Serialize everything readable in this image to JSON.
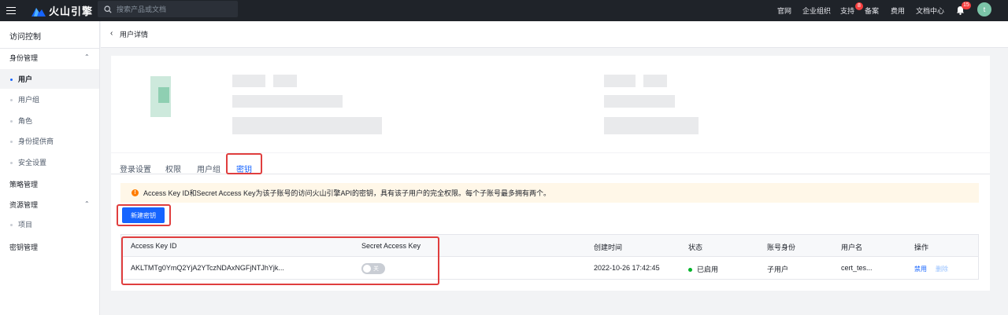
{
  "topbar": {
    "logo_text": "火山引擎",
    "search_placeholder": "搜索产品或文档",
    "nav": [
      "官网",
      "企业组织",
      "支持",
      "备案",
      "费用",
      "文档中心"
    ],
    "support_badge": "8",
    "bell_badge": "15",
    "avatar_letter": "t"
  },
  "sidebar": {
    "title": "访问控制",
    "group_identity": "身份管理",
    "identity_items": [
      "用户",
      "用户组",
      "角色",
      "身份提供商",
      "安全设置"
    ],
    "policy": "策略管理",
    "group_resource": "资源管理",
    "resource_items": [
      "项目"
    ],
    "key_mgmt": "密钥管理"
  },
  "header": {
    "back_glyph": "‹",
    "title": "用户详情"
  },
  "tabs": [
    "登录设置",
    "权限",
    "用户组",
    "密钥"
  ],
  "notice": {
    "text": "Access Key ID和Secret Access Key为该子账号的访问火山引擎API的密钥，具有该子用户的完全权限。每个子账号最多拥有两个。"
  },
  "new_key_button": "新建密钥",
  "table": {
    "headers": [
      "Access Key ID",
      "Secret Access Key",
      "创建时间",
      "状态",
      "账号身份",
      "用户名",
      "操作"
    ],
    "rows": [
      {
        "access_key_id": "AKLTMTg0YmQ2YjA2YTczNDAxNGFjNTJhYjk...",
        "secret_toggle": "关",
        "created_at": "2022-10-26 17:42:45",
        "status": "已启用",
        "identity": "子用户",
        "username": "cert_tes...",
        "action_disable": "禁用",
        "action_delete": "删除"
      }
    ]
  },
  "colors": {
    "primary": "#1664ff",
    "warning": "#ff7d00",
    "success": "#00b42a",
    "highlight": "#e03e3e"
  }
}
